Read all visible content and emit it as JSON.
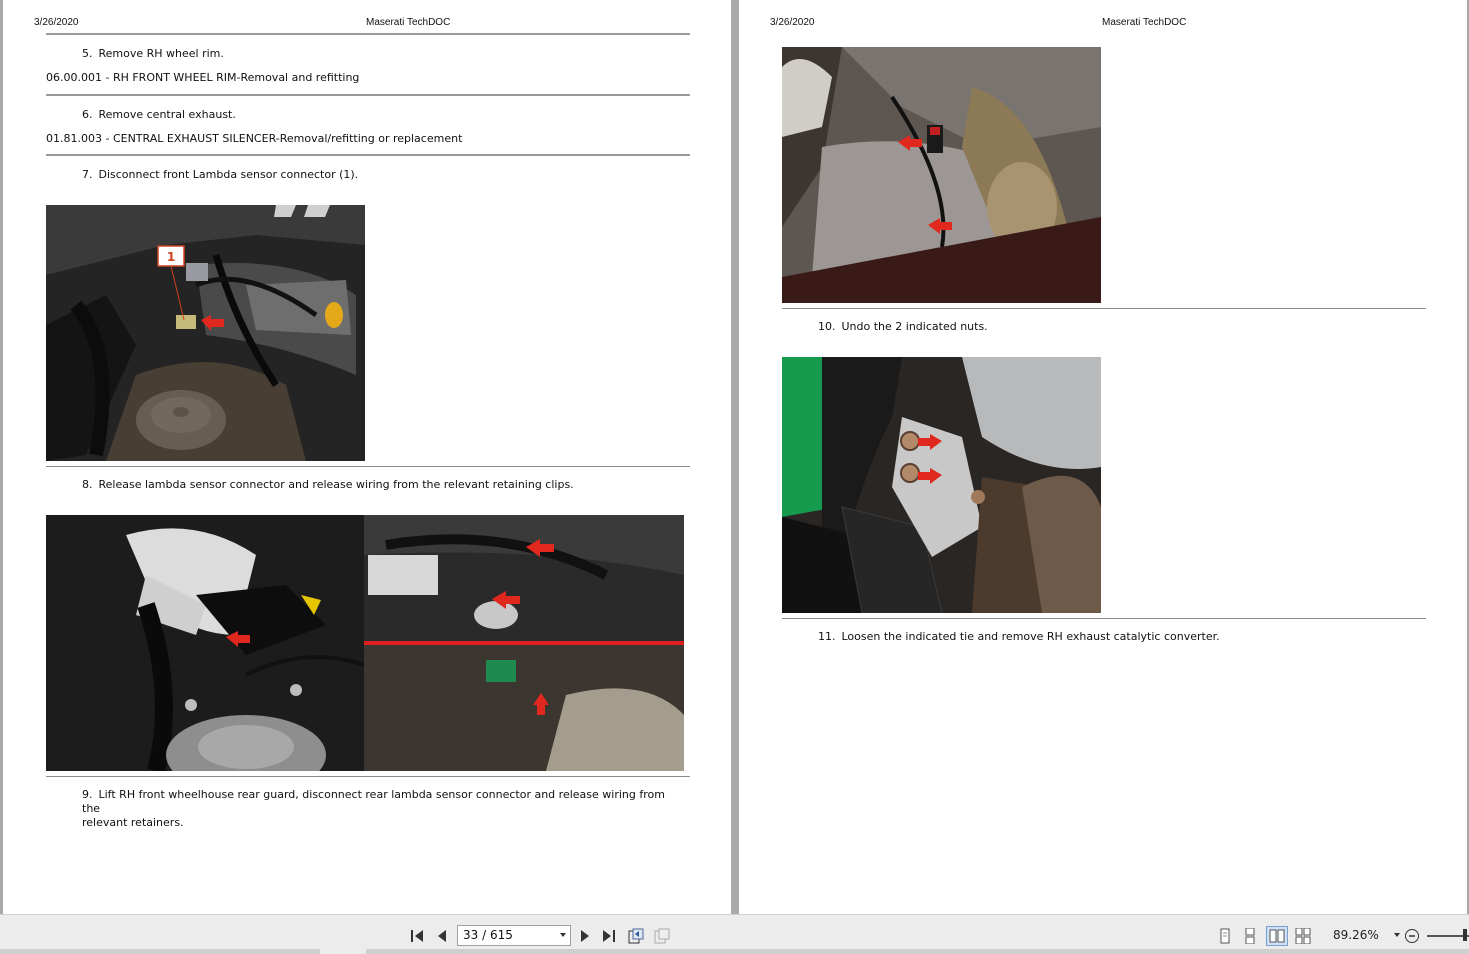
{
  "left_page": {
    "date": "3/26/2020",
    "title": "Maserati TechDOC",
    "steps": [
      {
        "num": "5.",
        "text": "Remove RH wheel rim.",
        "ref": "06.00.001 - RH FRONT WHEEL RIM-Removal and refitting"
      },
      {
        "num": "6.",
        "text": "Remove central exhaust.",
        "ref": "01.81.003 - CENTRAL EXHAUST SILENCER-Removal/refitting or replacement"
      },
      {
        "num": "7.",
        "text": "Disconnect front Lambda sensor connector (1)."
      },
      {
        "num": "8.",
        "text": "Release lambda sensor connector and release wiring from the relevant retaining clips."
      },
      {
        "num": "9.",
        "text": "Lift RH front wheelhouse rear guard, disconnect rear lambda sensor connector and release wiring from the",
        "text2": "relevant retainers."
      }
    ],
    "photo_callout": "1"
  },
  "right_page": {
    "date": "3/26/2020",
    "title": "Maserati TechDOC",
    "steps": [
      {
        "num": "10.",
        "text": "Undo the 2 indicated nuts."
      },
      {
        "num": "11.",
        "text": "Loosen the indicated tie and remove RH exhaust catalytic converter."
      }
    ]
  },
  "toolbar": {
    "page_indicator": "33 / 615",
    "zoom": "89.26%",
    "icons": [
      "first-page-icon",
      "prev-page-icon",
      "next-page-icon",
      "last-page-icon",
      "previous-view-icon",
      "next-view-icon",
      "single-page-icon",
      "continuous-page-icon",
      "facing-pages-icon",
      "continuous-facing-icon",
      "zoom-out-icon"
    ]
  },
  "colors": {
    "arrow_red": "#e0281e",
    "toolbar_bg": "#ececec",
    "viewer_bg": "#a9a9a9"
  }
}
